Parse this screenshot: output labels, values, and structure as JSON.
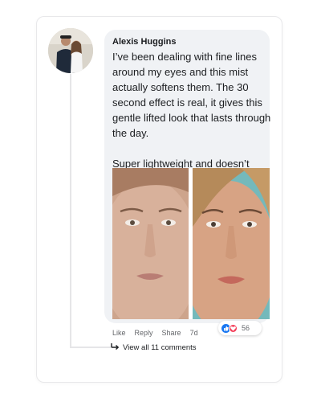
{
  "comment": {
    "author": "Alexis Huggins",
    "paragraphs": [
      "I’ve been dealing with fine lines around my eyes and this mist actually softens them. The 30 second effect is real, it gives this gentle lifted look that lasts through the day.",
      "Super lightweight and doesn’t mess with makeup at all"
    ]
  },
  "actions": {
    "like": "Like",
    "reply": "Reply",
    "share": "Share",
    "time": "7d"
  },
  "reactions": {
    "icons": [
      "like-icon",
      "love-icon"
    ],
    "count": "56"
  },
  "replies": {
    "view_all": "View all 11 comments"
  },
  "colors": {
    "bubble": "#f0f2f5",
    "like_blue": "#1877f2",
    "love_red": "#f33e58",
    "meta_gray": "#65676b"
  }
}
